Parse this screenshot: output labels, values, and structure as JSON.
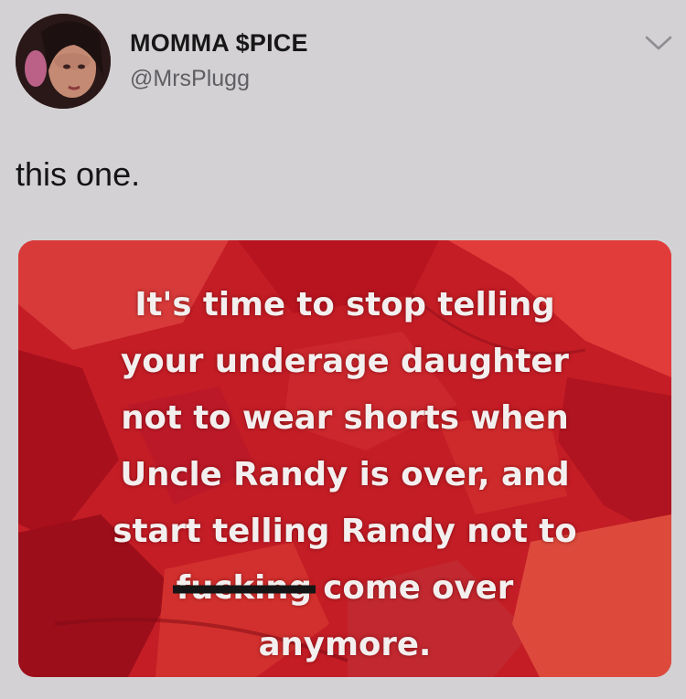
{
  "tweet": {
    "display_name": "MOMMA $PICE",
    "handle": "@MrsPlugg",
    "text": "this one.",
    "menu_icon": "chevron-down-icon"
  },
  "image": {
    "lines": [
      "It's time to stop telling",
      "your underage daughter",
      "not to wear shorts when",
      "Uncle Randy is over, and",
      "start telling Randy not to"
    ],
    "censored_word": "fucking",
    "line6_rest": " come over",
    "line7": "anymore."
  },
  "colors": {
    "background": "#d3d1d4",
    "media_red": "#c41d26",
    "meme_text": "#f3efef"
  }
}
